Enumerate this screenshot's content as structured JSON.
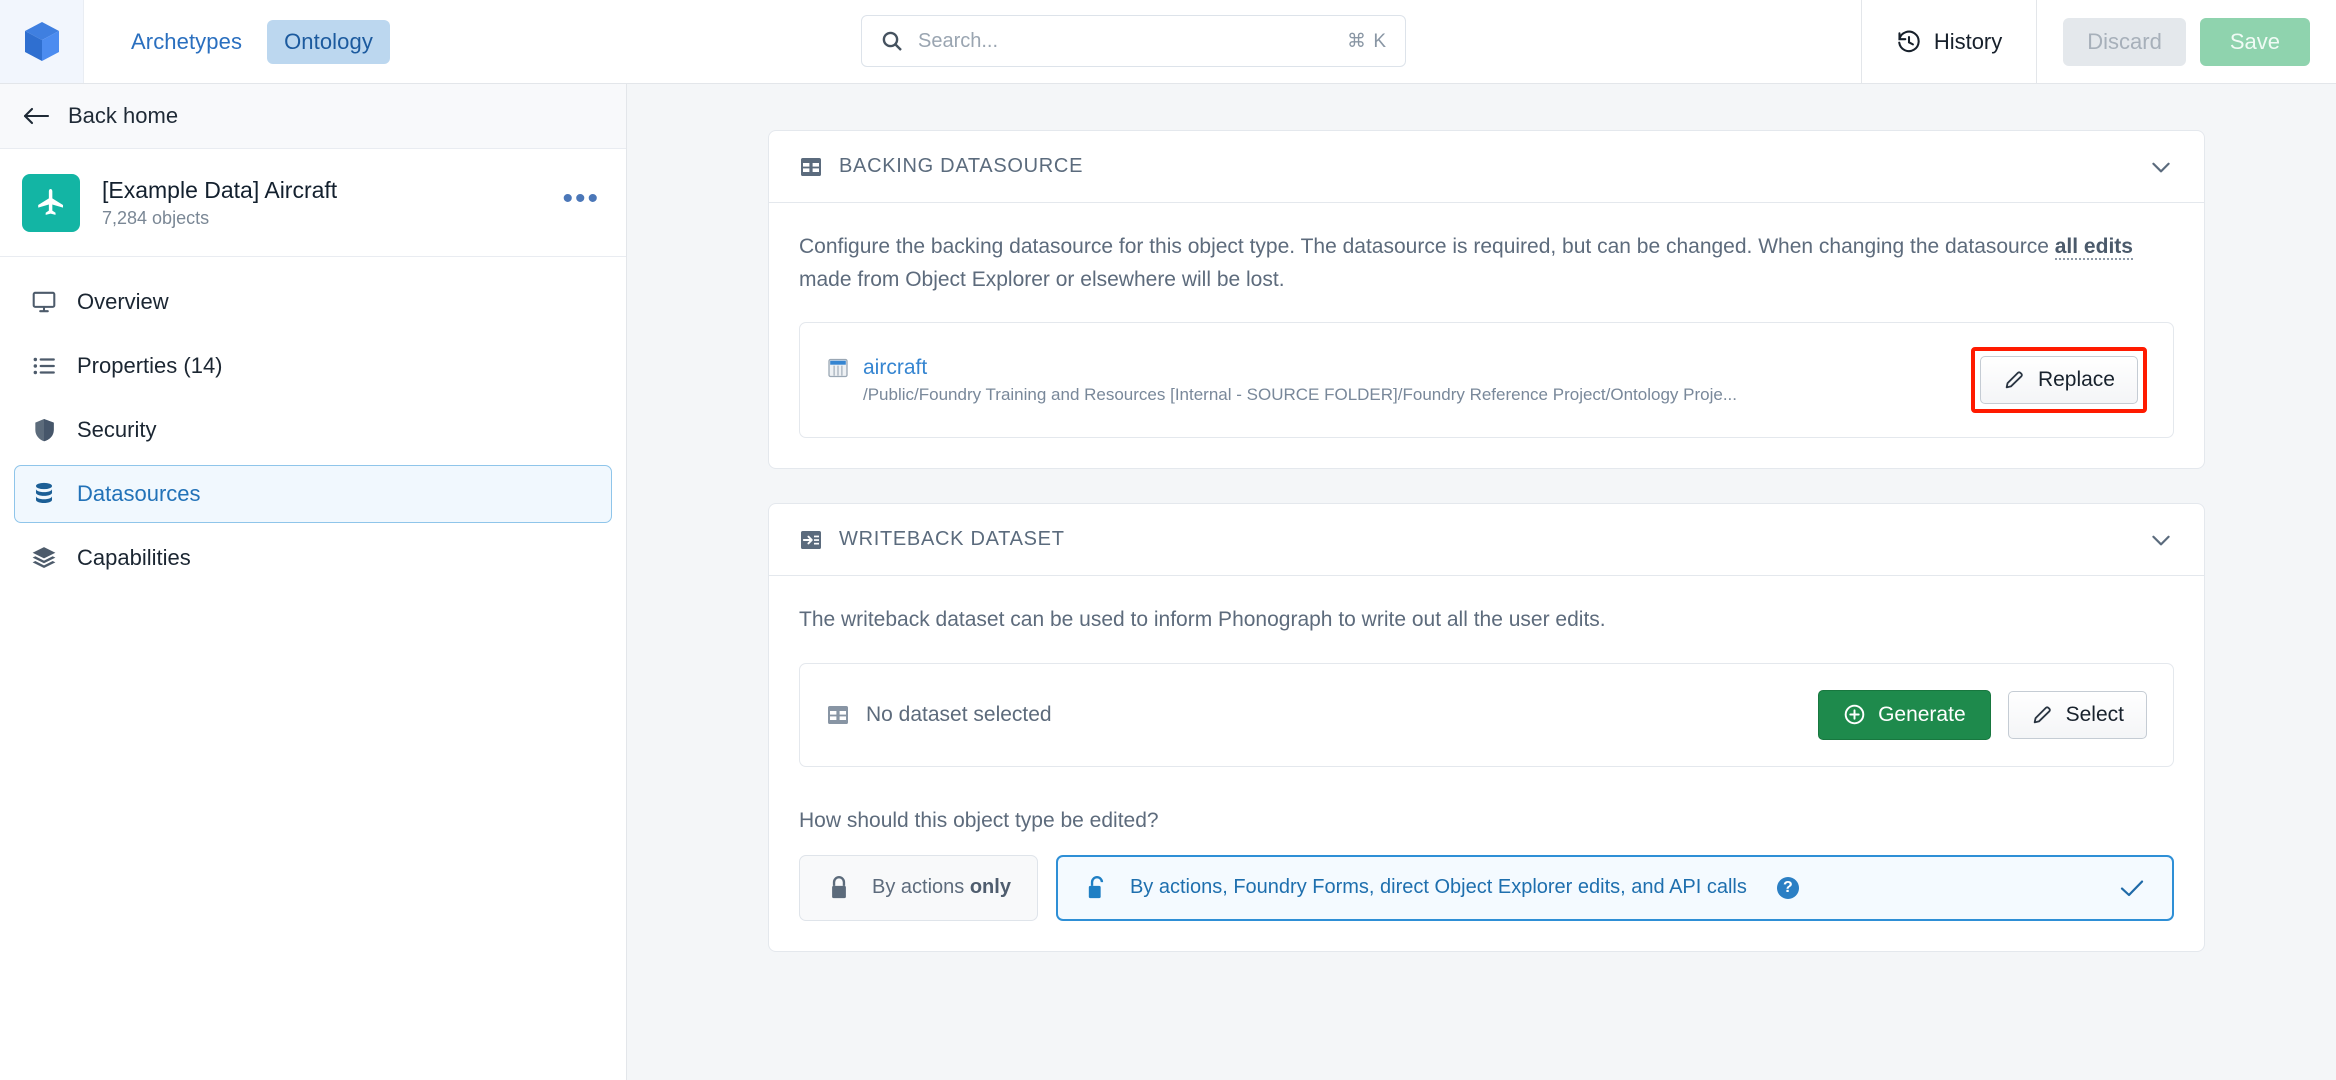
{
  "topbar": {
    "logo_icon": "cube-logo-icon",
    "tabs": [
      {
        "label": "Archetypes",
        "active": false
      },
      {
        "label": "Ontology",
        "active": true
      }
    ],
    "search": {
      "placeholder": "Search...",
      "shortcut": "⌘ K",
      "icon": "search-icon"
    },
    "history": {
      "label": "History",
      "icon": "history-icon"
    },
    "discard": {
      "label": "Discard"
    },
    "save": {
      "label": "Save"
    }
  },
  "sidebar": {
    "back": {
      "label": "Back home",
      "icon": "arrow-left-icon"
    },
    "object": {
      "title": "[Example Data] Aircraft",
      "subtitle": "7,284 objects",
      "icon": "airplane-icon",
      "more": "•••",
      "accent_color": "#13b5a4"
    },
    "items": [
      {
        "label": "Overview",
        "icon": "monitor-icon",
        "active": false
      },
      {
        "label": "Properties (14)",
        "icon": "list-icon",
        "active": false
      },
      {
        "label": "Security",
        "icon": "shield-icon",
        "active": false
      },
      {
        "label": "Datasources",
        "icon": "database-icon",
        "active": true
      },
      {
        "label": "Capabilities",
        "icon": "layers-icon",
        "active": false
      }
    ]
  },
  "main": {
    "backing_datasource": {
      "header": "BACKING DATASOURCE",
      "header_icon": "table-icon",
      "collapse_icon": "chevron-down-icon",
      "description_part1": "Configure the backing datasource for this object type. The datasource is required, but can be changed. When changing the datasource ",
      "description_bold": "all edits",
      "description_part2": " made from Object Explorer or elsewhere will be lost.",
      "datasource": {
        "name": "aircraft",
        "path": "/Public/Foundry Training and Resources [Internal - SOURCE FOLDER]/Foundry Reference Project/Ontology Proje...",
        "icon": "dataset-icon"
      },
      "replace_button": {
        "label": "Replace",
        "icon": "pencil-icon",
        "highlight_color": "#ff1a00"
      }
    },
    "writeback_dataset": {
      "header": "WRITEBACK DATASET",
      "header_icon": "writeback-icon",
      "collapse_icon": "chevron-down-icon",
      "description": "The writeback dataset can be used to inform Phonograph to write out all the user edits.",
      "empty_state": {
        "label": "No dataset selected",
        "icon": "table-icon"
      },
      "generate_button": {
        "label": "Generate",
        "icon": "plus-circle-icon",
        "color": "#1e8a4c"
      },
      "select_button": {
        "label": "Select",
        "icon": "pencil-icon"
      },
      "edit_question": "How should this object type be edited?",
      "options": [
        {
          "text_normal": "By actions ",
          "text_bold": "only",
          "icon": "lock-closed-icon",
          "selected": false
        },
        {
          "text_normal": "By actions, Foundry Forms, direct Object Explorer edits, and API calls",
          "text_bold": "",
          "icon": "lock-open-icon",
          "selected": true,
          "help_icon": "help-icon",
          "check_icon": "check-icon"
        }
      ]
    }
  }
}
